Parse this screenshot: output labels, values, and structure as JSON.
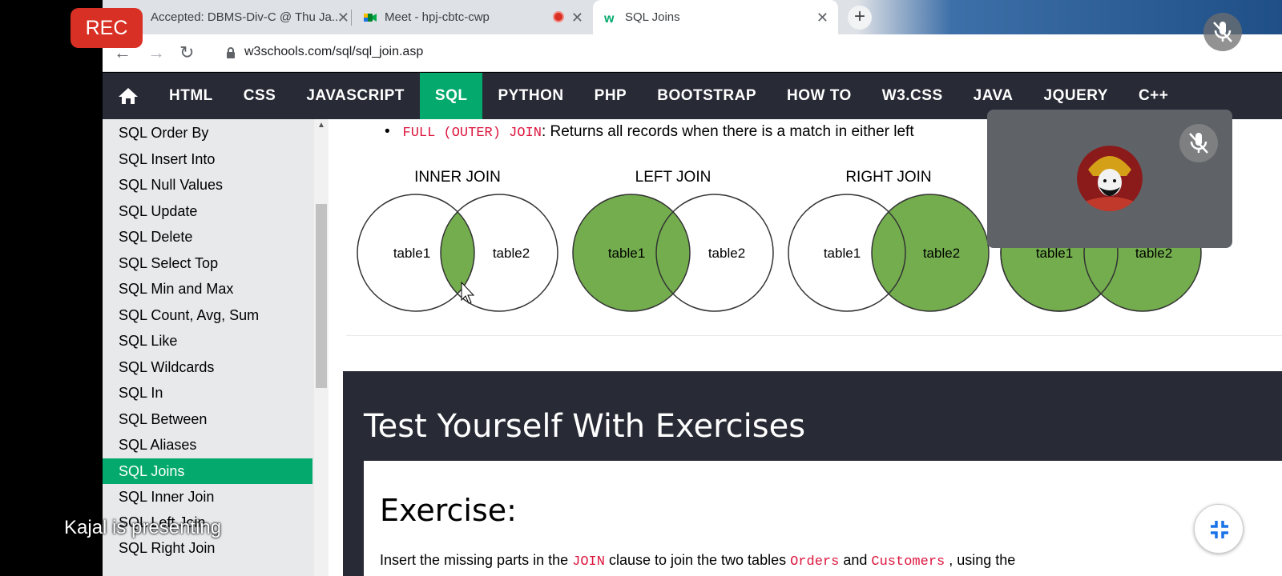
{
  "browser": {
    "tabs": [
      {
        "title": "Accepted: DBMS-Div-C @ Thu Ja...",
        "active": false
      },
      {
        "title": "Meet - hpj-cbtc-cwp",
        "active": false,
        "recording": true
      },
      {
        "title": "SQL Joins",
        "active": true
      }
    ],
    "url": "w3schools.com/sql/sql_join.asp"
  },
  "topnav": {
    "items": [
      "HTML",
      "CSS",
      "JAVASCRIPT",
      "SQL",
      "PYTHON",
      "PHP",
      "BOOTSTRAP",
      "HOW TO",
      "W3.CSS",
      "JAVA",
      "JQUERY",
      "C++"
    ],
    "active": "SQL"
  },
  "sidebar": {
    "items": [
      "SQL Order By",
      "SQL Insert Into",
      "SQL Null Values",
      "SQL Update",
      "SQL Delete",
      "SQL Select Top",
      "SQL Min and Max",
      "SQL Count, Avg, Sum",
      "SQL Like",
      "SQL Wildcards",
      "SQL In",
      "SQL Between",
      "SQL Aliases",
      "SQL Joins",
      "SQL Inner Join",
      "SQL Left Join",
      "SQL Right Join"
    ],
    "active": "SQL Joins"
  },
  "content": {
    "bullet_code": "FULL (OUTER) JOIN",
    "bullet_text": ": Returns all records when there is a match in either left",
    "diagrams": [
      {
        "title": "INNER JOIN",
        "left": "table1",
        "right": "table2"
      },
      {
        "title": "LEFT JOIN",
        "left": "table1",
        "right": "table2"
      },
      {
        "title": "RIGHT JOIN",
        "left": "table1",
        "right": "table2"
      },
      {
        "title": "",
        "left": "table1",
        "right": "table2"
      }
    ],
    "exercise_title": "Test Yourself With Exercises",
    "exercise_heading": "Exercise:",
    "exercise_text_1": "Insert the missing parts in the",
    "exercise_code_1": "JOIN",
    "exercise_text_2": "clause to join the two tables",
    "exercise_code_2": "Orders",
    "exercise_text_3": "and",
    "exercise_code_3": "Customers",
    "exercise_text_4": ", using the"
  },
  "meet": {
    "rec_label": "REC",
    "presenting": "Kajal is presenting"
  },
  "colors": {
    "accent": "#04aa6d",
    "venn_fill": "#73ad4e",
    "nav_bg": "#282a35",
    "rec": "#d93025"
  }
}
